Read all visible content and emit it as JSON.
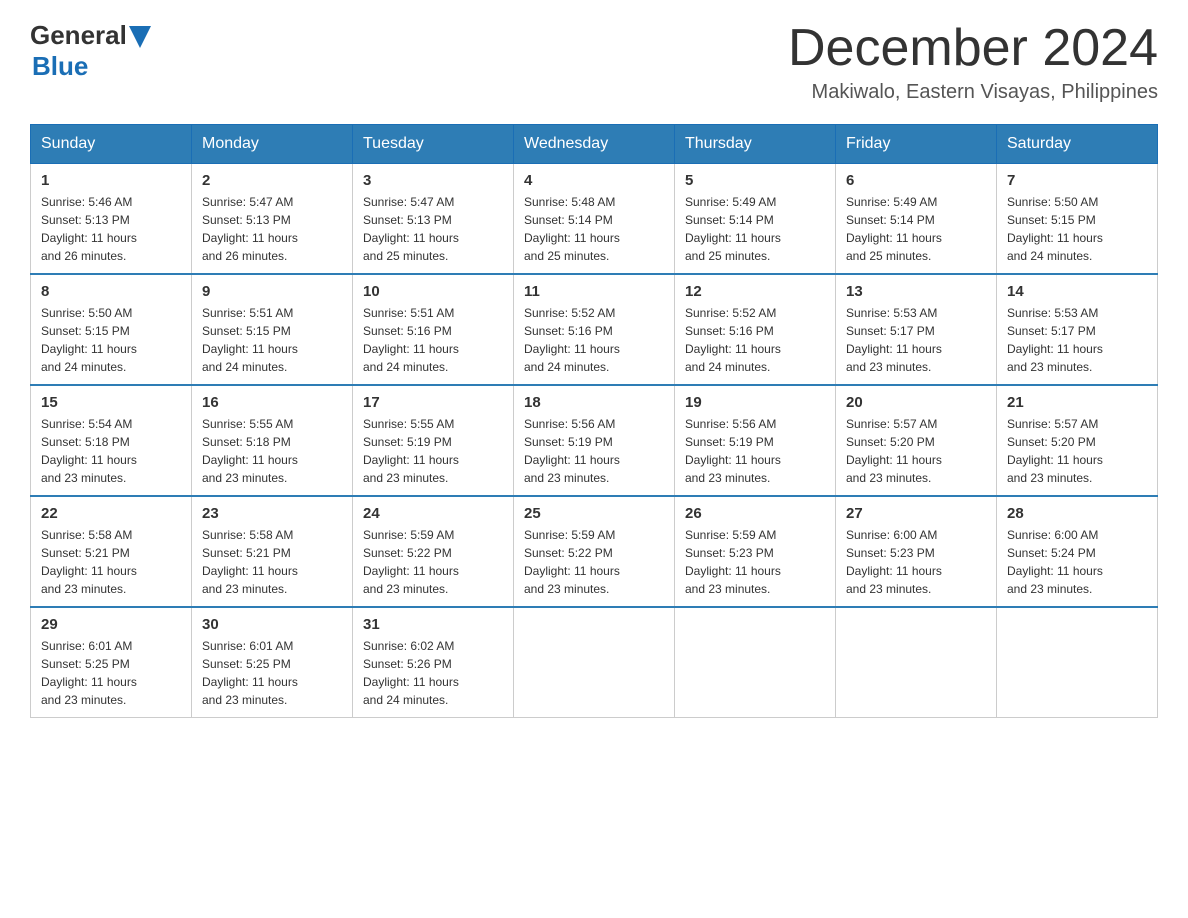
{
  "header": {
    "logo": {
      "general": "General",
      "blue": "Blue"
    },
    "month": "December 2024",
    "location": "Makiwalo, Eastern Visayas, Philippines"
  },
  "days_of_week": [
    "Sunday",
    "Monday",
    "Tuesday",
    "Wednesday",
    "Thursday",
    "Friday",
    "Saturday"
  ],
  "weeks": [
    [
      {
        "day": "1",
        "sunrise": "5:46 AM",
        "sunset": "5:13 PM",
        "daylight": "11 hours and 26 minutes."
      },
      {
        "day": "2",
        "sunrise": "5:47 AM",
        "sunset": "5:13 PM",
        "daylight": "11 hours and 26 minutes."
      },
      {
        "day": "3",
        "sunrise": "5:47 AM",
        "sunset": "5:13 PM",
        "daylight": "11 hours and 25 minutes."
      },
      {
        "day": "4",
        "sunrise": "5:48 AM",
        "sunset": "5:14 PM",
        "daylight": "11 hours and 25 minutes."
      },
      {
        "day": "5",
        "sunrise": "5:49 AM",
        "sunset": "5:14 PM",
        "daylight": "11 hours and 25 minutes."
      },
      {
        "day": "6",
        "sunrise": "5:49 AM",
        "sunset": "5:14 PM",
        "daylight": "11 hours and 25 minutes."
      },
      {
        "day": "7",
        "sunrise": "5:50 AM",
        "sunset": "5:15 PM",
        "daylight": "11 hours and 24 minutes."
      }
    ],
    [
      {
        "day": "8",
        "sunrise": "5:50 AM",
        "sunset": "5:15 PM",
        "daylight": "11 hours and 24 minutes."
      },
      {
        "day": "9",
        "sunrise": "5:51 AM",
        "sunset": "5:15 PM",
        "daylight": "11 hours and 24 minutes."
      },
      {
        "day": "10",
        "sunrise": "5:51 AM",
        "sunset": "5:16 PM",
        "daylight": "11 hours and 24 minutes."
      },
      {
        "day": "11",
        "sunrise": "5:52 AM",
        "sunset": "5:16 PM",
        "daylight": "11 hours and 24 minutes."
      },
      {
        "day": "12",
        "sunrise": "5:52 AM",
        "sunset": "5:16 PM",
        "daylight": "11 hours and 24 minutes."
      },
      {
        "day": "13",
        "sunrise": "5:53 AM",
        "sunset": "5:17 PM",
        "daylight": "11 hours and 23 minutes."
      },
      {
        "day": "14",
        "sunrise": "5:53 AM",
        "sunset": "5:17 PM",
        "daylight": "11 hours and 23 minutes."
      }
    ],
    [
      {
        "day": "15",
        "sunrise": "5:54 AM",
        "sunset": "5:18 PM",
        "daylight": "11 hours and 23 minutes."
      },
      {
        "day": "16",
        "sunrise": "5:55 AM",
        "sunset": "5:18 PM",
        "daylight": "11 hours and 23 minutes."
      },
      {
        "day": "17",
        "sunrise": "5:55 AM",
        "sunset": "5:19 PM",
        "daylight": "11 hours and 23 minutes."
      },
      {
        "day": "18",
        "sunrise": "5:56 AM",
        "sunset": "5:19 PM",
        "daylight": "11 hours and 23 minutes."
      },
      {
        "day": "19",
        "sunrise": "5:56 AM",
        "sunset": "5:19 PM",
        "daylight": "11 hours and 23 minutes."
      },
      {
        "day": "20",
        "sunrise": "5:57 AM",
        "sunset": "5:20 PM",
        "daylight": "11 hours and 23 minutes."
      },
      {
        "day": "21",
        "sunrise": "5:57 AM",
        "sunset": "5:20 PM",
        "daylight": "11 hours and 23 minutes."
      }
    ],
    [
      {
        "day": "22",
        "sunrise": "5:58 AM",
        "sunset": "5:21 PM",
        "daylight": "11 hours and 23 minutes."
      },
      {
        "day": "23",
        "sunrise": "5:58 AM",
        "sunset": "5:21 PM",
        "daylight": "11 hours and 23 minutes."
      },
      {
        "day": "24",
        "sunrise": "5:59 AM",
        "sunset": "5:22 PM",
        "daylight": "11 hours and 23 minutes."
      },
      {
        "day": "25",
        "sunrise": "5:59 AM",
        "sunset": "5:22 PM",
        "daylight": "11 hours and 23 minutes."
      },
      {
        "day": "26",
        "sunrise": "5:59 AM",
        "sunset": "5:23 PM",
        "daylight": "11 hours and 23 minutes."
      },
      {
        "day": "27",
        "sunrise": "6:00 AM",
        "sunset": "5:23 PM",
        "daylight": "11 hours and 23 minutes."
      },
      {
        "day": "28",
        "sunrise": "6:00 AM",
        "sunset": "5:24 PM",
        "daylight": "11 hours and 23 minutes."
      }
    ],
    [
      {
        "day": "29",
        "sunrise": "6:01 AM",
        "sunset": "5:25 PM",
        "daylight": "11 hours and 23 minutes."
      },
      {
        "day": "30",
        "sunrise": "6:01 AM",
        "sunset": "5:25 PM",
        "daylight": "11 hours and 23 minutes."
      },
      {
        "day": "31",
        "sunrise": "6:02 AM",
        "sunset": "5:26 PM",
        "daylight": "11 hours and 24 minutes."
      },
      null,
      null,
      null,
      null
    ]
  ],
  "labels": {
    "sunrise": "Sunrise:",
    "sunset": "Sunset:",
    "daylight": "Daylight:"
  }
}
